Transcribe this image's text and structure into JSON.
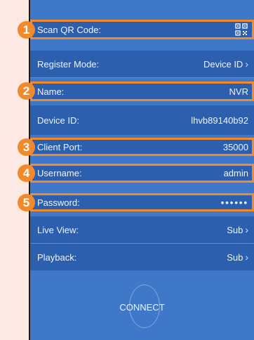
{
  "badges": [
    "1",
    "2",
    "3",
    "4",
    "5"
  ],
  "rows": {
    "scan_qr": {
      "label": "Scan QR Code:"
    },
    "register_mode": {
      "label": "Register Mode:",
      "value": "Device ID"
    },
    "name": {
      "label": "Name:",
      "value": "NVR"
    },
    "device_id": {
      "label": "Device ID:",
      "value": "lhvb89140b92"
    },
    "client_port": {
      "label": "Client Port:",
      "value": "35000"
    },
    "username": {
      "label": "Username:",
      "value": "admin"
    },
    "password": {
      "label": "Password:",
      "value": "••••••"
    },
    "live_view": {
      "label": "Live View:",
      "value": "Sub"
    },
    "playback": {
      "label": "Playback:",
      "value": "Sub"
    }
  },
  "connect_label": "CONNECT",
  "icons": {
    "qr": "qr-code-icon",
    "chevron": "chevron-right-icon"
  },
  "colors": {
    "badge": "#f28a2c",
    "panel": "#3f78c8",
    "row": "#2c5fae",
    "background": "#fde9e3"
  }
}
